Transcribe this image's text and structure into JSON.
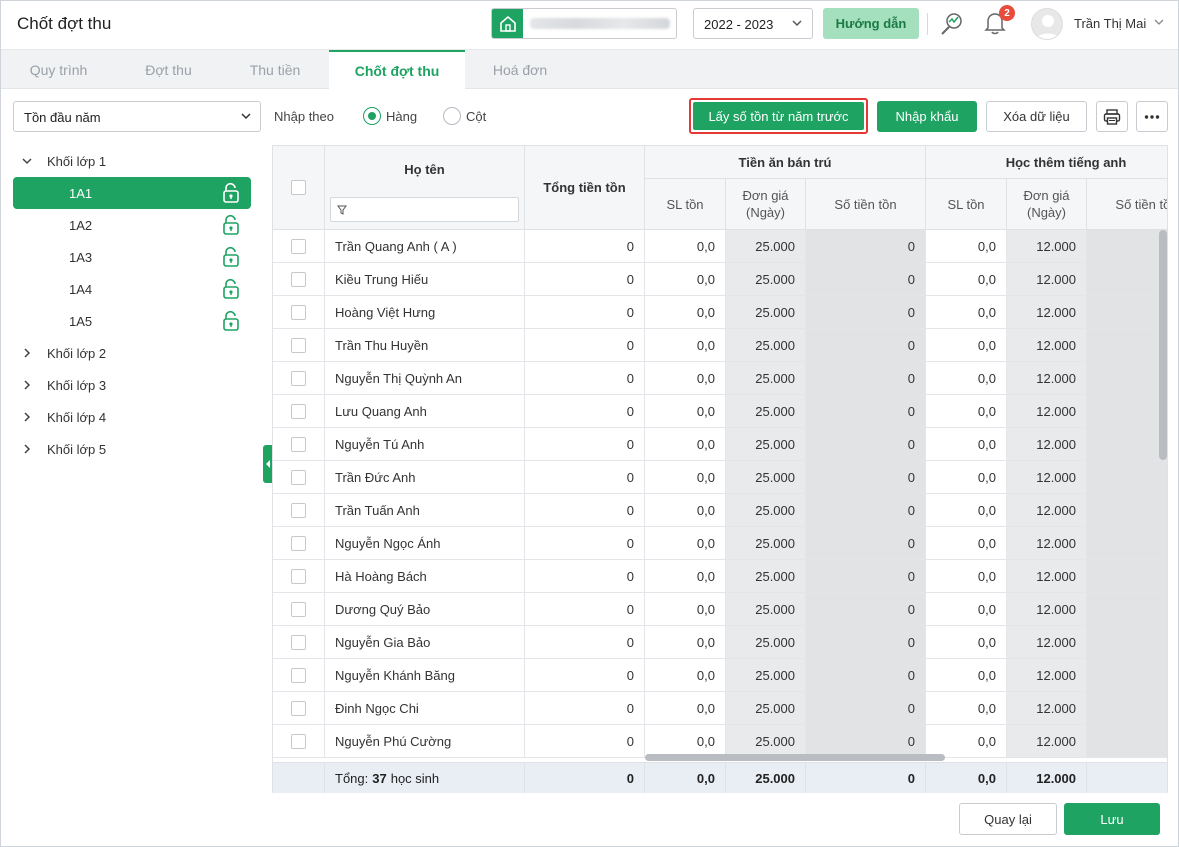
{
  "header": {
    "title": "Chốt đợt thu",
    "year": "2022 - 2023",
    "guide_label": "Hướng dẫn",
    "notification_count": "2",
    "user_name": "Trần Thị Mai"
  },
  "tabs": [
    {
      "label": "Quy trình",
      "active": false
    },
    {
      "label": "Đợt thu",
      "active": false
    },
    {
      "label": "Thu tiền",
      "active": false
    },
    {
      "label": "Chốt đợt thu",
      "active": true
    },
    {
      "label": "Hoá đơn",
      "active": false
    }
  ],
  "toolbar": {
    "period": "Tồn đầu năm",
    "mode_label": "Nhập theo",
    "mode_row": "Hàng",
    "mode_col": "Cột",
    "mode_selected": "Hàng",
    "btn_prev_year": "Lấy số tồn từ năm trước",
    "btn_import": "Nhập khẩu",
    "btn_clear": "Xóa dữ liệu"
  },
  "tree": {
    "groups": [
      {
        "label": "Khối lớp 1",
        "expanded": true,
        "classes": [
          "1A1",
          "1A2",
          "1A3",
          "1A4",
          "1A5"
        ],
        "selected": "1A1"
      },
      {
        "label": "Khối lớp 2",
        "expanded": false
      },
      {
        "label": "Khối lớp 3",
        "expanded": false
      },
      {
        "label": "Khối lớp 4",
        "expanded": false
      },
      {
        "label": "Khối lớp 5",
        "expanded": false
      }
    ]
  },
  "grid": {
    "headers": {
      "name": "Họ tên",
      "total": "Tổng tiền tồn",
      "group1": "Tiền ăn bán trú",
      "group2": "Học thêm tiếng anh",
      "qty": "SL tồn",
      "price": "Đơn giá (Ngày)",
      "amount": "Số tiền tồn"
    },
    "rows": [
      {
        "name": "Trần Quang Anh ( A )",
        "total": "0",
        "qty1": "0,0",
        "price1": "25.000",
        "amount1": "0",
        "qty2": "0,0",
        "price2": "12.000"
      },
      {
        "name": "Kiều Trung Hiếu",
        "total": "0",
        "qty1": "0,0",
        "price1": "25.000",
        "amount1": "0",
        "qty2": "0,0",
        "price2": "12.000"
      },
      {
        "name": "Hoàng Việt Hưng",
        "total": "0",
        "qty1": "0,0",
        "price1": "25.000",
        "amount1": "0",
        "qty2": "0,0",
        "price2": "12.000"
      },
      {
        "name": "Trần Thu Huyền",
        "total": "0",
        "qty1": "0,0",
        "price1": "25.000",
        "amount1": "0",
        "qty2": "0,0",
        "price2": "12.000"
      },
      {
        "name": "Nguyễn Thị Quỳnh An",
        "total": "0",
        "qty1": "0,0",
        "price1": "25.000",
        "amount1": "0",
        "qty2": "0,0",
        "price2": "12.000"
      },
      {
        "name": "Lưu Quang Anh",
        "total": "0",
        "qty1": "0,0",
        "price1": "25.000",
        "amount1": "0",
        "qty2": "0,0",
        "price2": "12.000"
      },
      {
        "name": "Nguyễn Tú Anh",
        "total": "0",
        "qty1": "0,0",
        "price1": "25.000",
        "amount1": "0",
        "qty2": "0,0",
        "price2": "12.000"
      },
      {
        "name": "Trần Đức Anh",
        "total": "0",
        "qty1": "0,0",
        "price1": "25.000",
        "amount1": "0",
        "qty2": "0,0",
        "price2": "12.000"
      },
      {
        "name": "Trần Tuấn Anh",
        "total": "0",
        "qty1": "0,0",
        "price1": "25.000",
        "amount1": "0",
        "qty2": "0,0",
        "price2": "12.000"
      },
      {
        "name": "Nguyễn Ngọc Ánh",
        "total": "0",
        "qty1": "0,0",
        "price1": "25.000",
        "amount1": "0",
        "qty2": "0,0",
        "price2": "12.000"
      },
      {
        "name": "Hà Hoàng Bách",
        "total": "0",
        "qty1": "0,0",
        "price1": "25.000",
        "amount1": "0",
        "qty2": "0,0",
        "price2": "12.000"
      },
      {
        "name": "Dương Quý Bảo",
        "total": "0",
        "qty1": "0,0",
        "price1": "25.000",
        "amount1": "0",
        "qty2": "0,0",
        "price2": "12.000"
      },
      {
        "name": "Nguyễn Gia Bảo",
        "total": "0",
        "qty1": "0,0",
        "price1": "25.000",
        "amount1": "0",
        "qty2": "0,0",
        "price2": "12.000"
      },
      {
        "name": "Nguyễn Khánh Băng",
        "total": "0",
        "qty1": "0,0",
        "price1": "25.000",
        "amount1": "0",
        "qty2": "0,0",
        "price2": "12.000"
      },
      {
        "name": "Đinh Ngọc Chi",
        "total": "0",
        "qty1": "0,0",
        "price1": "25.000",
        "amount1": "0",
        "qty2": "0,0",
        "price2": "12.000"
      },
      {
        "name": "Nguyễn Phú Cường",
        "total": "0",
        "qty1": "0,0",
        "price1": "25.000",
        "amount1": "0",
        "qty2": "0,0",
        "price2": "12.000"
      }
    ],
    "footer": {
      "label": "Tổng:",
      "count": "37",
      "unit": "học sinh",
      "total": "0",
      "qty1": "0,0",
      "price1": "25.000",
      "amount1": "0",
      "qty2": "0,0",
      "price2": "12.000"
    }
  },
  "bottom": {
    "back_label": "Quay lại",
    "save_label": "Lưu"
  },
  "colors": {
    "accent": "#1ea362",
    "highlight_border": "#e53935"
  }
}
